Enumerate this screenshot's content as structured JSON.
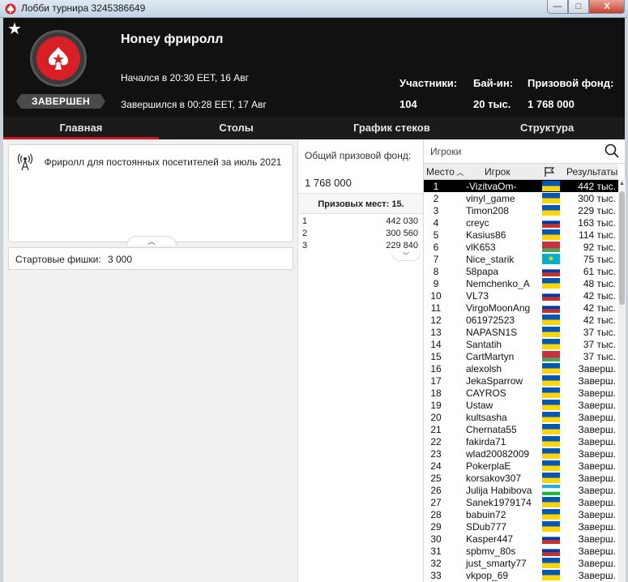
{
  "window": {
    "title": "Лобби турнира 3245386649",
    "buttons": [
      "—",
      "□",
      "X"
    ]
  },
  "header": {
    "tournament_name": "Honey фриролл",
    "status": "ЗАВЕРШЕН",
    "started": "Начался в 20:30 EET, 16 Авг",
    "ended": "Завершился в 00:28 EET, 17 Авг",
    "stats": [
      {
        "label": "Участники:",
        "value": "104"
      },
      {
        "label": "Бай-ин:",
        "value": "20 тыс."
      },
      {
        "label": "Призовой фонд:",
        "value": "1 768 000"
      }
    ]
  },
  "tabs": [
    {
      "label": "Главная",
      "active": true
    },
    {
      "label": "Столы",
      "active": false
    },
    {
      "label": "График стеков",
      "active": false
    },
    {
      "label": "Структура",
      "active": false
    }
  ],
  "info": {
    "description": "Фриролл для постоянных посетителей за июль 2021",
    "starting_chips_label": "Стартовые фишки:",
    "starting_chips_value": "3 000"
  },
  "prizes": {
    "pool_label": "Общий призовой фонд:",
    "pool_value": "1 768 000",
    "places_label": "Призовых мест: 15.",
    "rows": [
      {
        "place": "1",
        "amount": "442 030"
      },
      {
        "place": "2",
        "amount": "300 560"
      },
      {
        "place": "3",
        "amount": "229 840"
      }
    ]
  },
  "players": {
    "search_label": "Игроки",
    "columns": {
      "place": "Место",
      "player": "Игрок",
      "results": "Результаты"
    },
    "rows": [
      {
        "place": "1",
        "name": "-VizitvaOm-",
        "flag": "UA",
        "result": "442 тыс.",
        "selected": true
      },
      {
        "place": "2",
        "name": "vinyl_game",
        "flag": "UA",
        "result": "300 тыс."
      },
      {
        "place": "3",
        "name": "Timon208",
        "flag": "UA",
        "result": "229 тыс."
      },
      {
        "place": "4",
        "name": "creyc",
        "flag": "RU",
        "result": "163 тыс."
      },
      {
        "place": "5",
        "name": "Kasius86",
        "flag": "UA",
        "result": "114 тыс."
      },
      {
        "place": "6",
        "name": "vlK653",
        "flag": "BY",
        "result": "92 тыс."
      },
      {
        "place": "7",
        "name": "Nice_starik",
        "flag": "KZ",
        "result": "75 тыс."
      },
      {
        "place": "8",
        "name": "58papa",
        "flag": "RU",
        "result": "61 тыс."
      },
      {
        "place": "9",
        "name": "Nemchenko_A",
        "flag": "UA",
        "result": "48 тыс."
      },
      {
        "place": "10",
        "name": "VL73",
        "flag": "RU",
        "result": "42 тыс."
      },
      {
        "place": "11",
        "name": "VirgoMoonAng",
        "flag": "RU",
        "result": "42 тыс."
      },
      {
        "place": "12",
        "name": "061972523",
        "flag": "UA",
        "result": "42 тыс."
      },
      {
        "place": "13",
        "name": "NAPASN1S",
        "flag": "UA",
        "result": "37 тыс."
      },
      {
        "place": "14",
        "name": "Santatih",
        "flag": "UA",
        "result": "37 тыс."
      },
      {
        "place": "15",
        "name": "CartMartyn",
        "flag": "BY",
        "result": "37 тыс."
      },
      {
        "place": "16",
        "name": "alexolsh",
        "flag": "UA",
        "result": "Заверш."
      },
      {
        "place": "17",
        "name": "JekaSparrow",
        "flag": "UA",
        "result": "Заверш."
      },
      {
        "place": "18",
        "name": "CAYROS",
        "flag": "UA",
        "result": "Заверш."
      },
      {
        "place": "19",
        "name": "Ustaw",
        "flag": "UA",
        "result": "Заверш."
      },
      {
        "place": "20",
        "name": "kultsasha",
        "flag": "UA",
        "result": "Заверш."
      },
      {
        "place": "21",
        "name": "Chernata55",
        "flag": "UA",
        "result": "Заверш."
      },
      {
        "place": "22",
        "name": "fakirda71",
        "flag": "UA",
        "result": "Заверш."
      },
      {
        "place": "23",
        "name": "wlad20082009",
        "flag": "UA",
        "result": "Заверш."
      },
      {
        "place": "24",
        "name": "PokerplaE",
        "flag": "UA",
        "result": "Заверш."
      },
      {
        "place": "25",
        "name": "korsakov307",
        "flag": "UA",
        "result": "Заверш."
      },
      {
        "place": "26",
        "name": "Julija Habibova",
        "flag": "UZ",
        "result": "Заверш."
      },
      {
        "place": "27",
        "name": "Sanek1979174",
        "flag": "UA",
        "result": "Заверш."
      },
      {
        "place": "28",
        "name": "babuin72",
        "flag": "UA",
        "result": "Заверш."
      },
      {
        "place": "29",
        "name": "SDub777",
        "flag": "UA",
        "result": "Заверш."
      },
      {
        "place": "30",
        "name": "Kasper447",
        "flag": "RU",
        "result": "Заверш."
      },
      {
        "place": "31",
        "name": "spbmv_80s",
        "flag": "RU",
        "result": "Заверш."
      },
      {
        "place": "32",
        "name": "just_smarty77",
        "flag": "UA",
        "result": "Заверш."
      },
      {
        "place": "33",
        "name": "vkpop_69",
        "flag": "UA",
        "result": "Заверш."
      }
    ]
  },
  "colors": {
    "accent": "#d0161e",
    "header_bg": "#111111",
    "tab_bg": "#1b1b1b"
  }
}
